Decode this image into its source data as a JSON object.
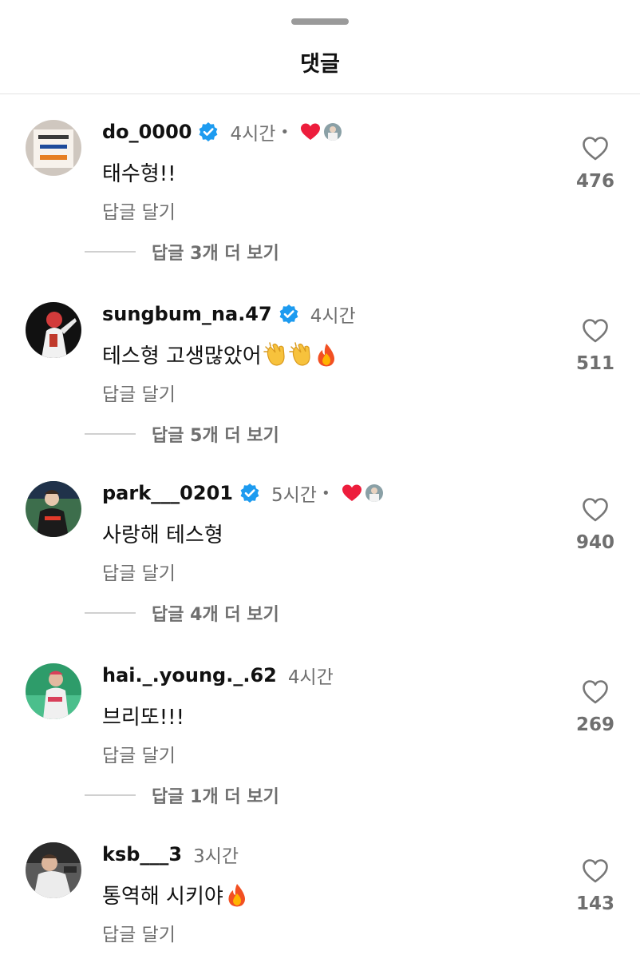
{
  "sheet": {
    "title": "댓글"
  },
  "comments": [
    {
      "username": "do_0000",
      "verified": true,
      "time": "4시간",
      "liked_by_author": true,
      "text": "태수형!!",
      "reply": "답글 달기",
      "likes": "476",
      "more_replies": "답글 3개 더 보기",
      "avatar_theme": "sign"
    },
    {
      "username": "sungbum_na.47",
      "verified": true,
      "time": "4시간",
      "liked_by_author": false,
      "text": "테스형 고생많았어",
      "emojis": [
        "clapping-hands-emoji",
        "clapping-hands-emoji",
        "fire-emoji"
      ],
      "reply": "답글 달기",
      "likes": "511",
      "more_replies": "답글 5개 더 보기",
      "avatar_theme": "player-dark"
    },
    {
      "username": "park___0201",
      "verified": true,
      "time": "5시간",
      "liked_by_author": true,
      "text": "사랑해 테스형",
      "reply": "답글 달기",
      "likes": "940",
      "more_replies": "답글 4개 더 보기",
      "avatar_theme": "player-field"
    },
    {
      "username": "hai._.young._.62",
      "verified": false,
      "time": "4시간",
      "liked_by_author": false,
      "text": "브리또!!!",
      "reply": "답글 달기",
      "likes": "269",
      "more_replies": "답글 1개 더 보기",
      "avatar_theme": "player-green"
    },
    {
      "username": "ksb___3",
      "verified": false,
      "time": "3시간",
      "liked_by_author": false,
      "text": "통역해 시키야",
      "emojis": [
        "fire-emoji"
      ],
      "reply": "답글 달기",
      "likes": "143",
      "avatar_theme": "player-stadium"
    }
  ],
  "colors": {
    "verified": "#1d9bf0",
    "heart_red": "#ed1d3c",
    "muted_text": "#6f6f6f"
  }
}
